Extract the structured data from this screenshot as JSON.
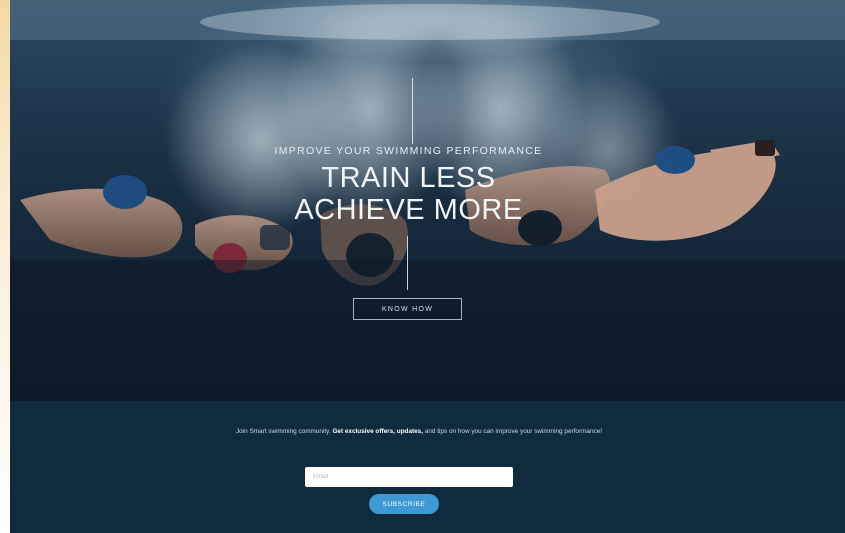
{
  "hero": {
    "subtitle": "IMPROVE YOUR SWIMMING PERFORMANCE",
    "title_line1": "TRAIN LESS",
    "title_line2": "ACHIEVE MORE",
    "cta_label": "KNOW HOW"
  },
  "newsletter": {
    "text_intro": "Join Smart swimming community. ",
    "text_bold": "Get exclusive offers, updates,",
    "text_outro": " and tips on how you can improve your swimming performance!",
    "email_placeholder": "Email",
    "subscribe_label": "SUBSCRIBE"
  },
  "colors": {
    "hero_background": "#1c3247",
    "newsletter_background": "#0f2b3d",
    "subscribe_button": "#3d98d4",
    "accent_strip": "#f3d9a3"
  }
}
